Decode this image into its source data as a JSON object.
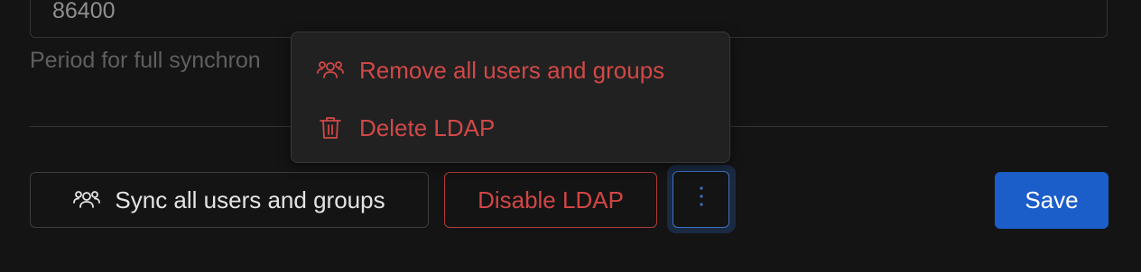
{
  "sync_period": {
    "value": "86400",
    "helper_text": "Period for full synchron"
  },
  "actions": {
    "sync_label": "Sync all users and groups",
    "disable_label": "Disable LDAP",
    "more_label": "⋮",
    "save_label": "Save"
  },
  "menu": {
    "items": [
      {
        "label": "Remove all users and groups",
        "icon": "users-icon"
      },
      {
        "label": "Delete LDAP",
        "icon": "trash-icon"
      }
    ]
  },
  "colors": {
    "danger": "#d14848",
    "primary": "#1c5ec9",
    "focus_ring": "#3d72c2",
    "background": "#141414"
  }
}
